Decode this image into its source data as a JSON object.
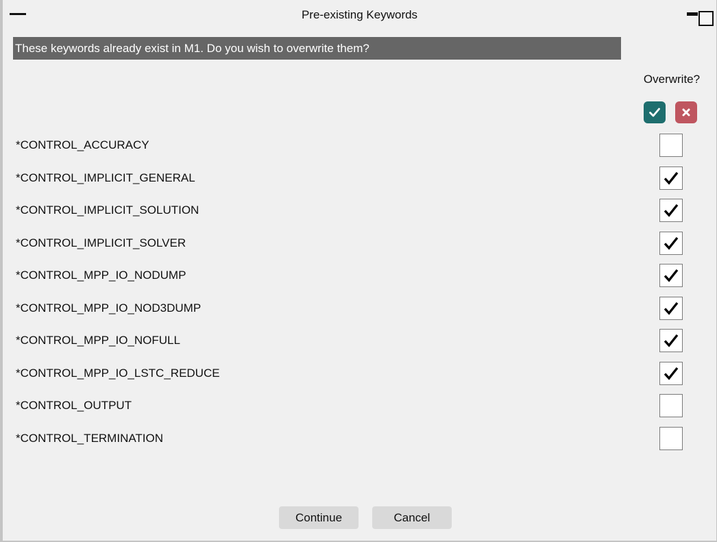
{
  "window": {
    "title": "Pre-existing Keywords"
  },
  "banner": {
    "text": "These keywords already exist in M1. Do you wish to overwrite them?"
  },
  "table": {
    "column_header": "Overwrite?",
    "rows": [
      {
        "label": "*CONTROL_ACCURACY",
        "checked": false
      },
      {
        "label": "*CONTROL_IMPLICIT_GENERAL",
        "checked": true
      },
      {
        "label": "*CONTROL_IMPLICIT_SOLUTION",
        "checked": true
      },
      {
        "label": "*CONTROL_IMPLICIT_SOLVER",
        "checked": true
      },
      {
        "label": "*CONTROL_MPP_IO_NODUMP",
        "checked": true
      },
      {
        "label": "*CONTROL_MPP_IO_NOD3DUMP",
        "checked": true
      },
      {
        "label": "*CONTROL_MPP_IO_NOFULL",
        "checked": true
      },
      {
        "label": "*CONTROL_MPP_IO_LSTC_REDUCE",
        "checked": true
      },
      {
        "label": "*CONTROL_OUTPUT",
        "checked": false
      },
      {
        "label": "*CONTROL_TERMINATION",
        "checked": false
      }
    ]
  },
  "buttons": {
    "continue_label": "Continue",
    "cancel_label": "Cancel"
  },
  "icons": {
    "minimize": "minimize-icon",
    "restore": "restore-icon",
    "select_all": "check-icon",
    "deselect_all": "cross-icon"
  },
  "colors": {
    "banner_bg": "#666666",
    "select_all_bg": "#1e6e6e",
    "deselect_all_bg": "#bf5660"
  }
}
